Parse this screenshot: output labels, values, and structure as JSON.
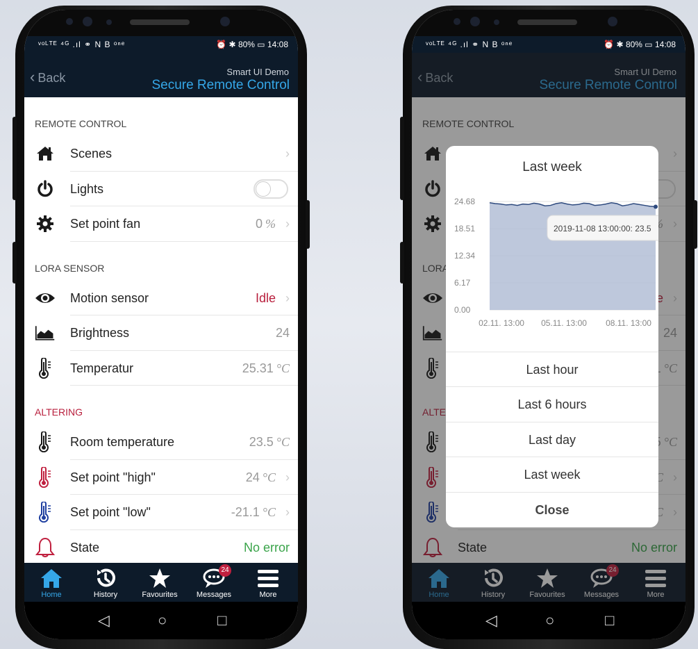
{
  "status": {
    "left_icons": "ᵛᵒᴸᵀᴱ ⁴ᴳ .ıl ⚭ N B ᵒⁿᵉ",
    "right": "⏰ ✱ 80% ▭ 14:08"
  },
  "header": {
    "back_label": "Back",
    "app_subtitle": "Smart UI Demo",
    "app_title": "Secure Remote Control"
  },
  "sections": {
    "remote": "REMOTE CONTROL",
    "lora": "LORA SENSOR",
    "altering": "ALTERING"
  },
  "rows": {
    "scenes": {
      "label": "Scenes"
    },
    "lights": {
      "label": "Lights",
      "on": false
    },
    "fan": {
      "label": "Set point fan",
      "value": "0",
      "unit": "%"
    },
    "motion": {
      "label": "Motion sensor",
      "value": "Idle"
    },
    "brightness": {
      "label": "Brightness",
      "value": "24"
    },
    "temperatur": {
      "label": "Temperatur",
      "value": "25.31",
      "unit": "°C"
    },
    "room": {
      "label": "Room temperature",
      "value": "23.5",
      "unit": "°C"
    },
    "high": {
      "label": "Set point \"high\"",
      "value": "24",
      "unit": "°C"
    },
    "low": {
      "label": "Set point \"low\"",
      "value": "-21.1",
      "unit": "°C"
    },
    "state": {
      "label": "State",
      "value": "No error"
    }
  },
  "tabs": [
    {
      "label": "Home",
      "icon": "home-icon"
    },
    {
      "label": "History",
      "icon": "history-icon"
    },
    {
      "label": "Favourites",
      "icon": "star-icon"
    },
    {
      "label": "Messages",
      "icon": "messages-icon",
      "badge": "24"
    },
    {
      "label": "More",
      "icon": "menu-icon"
    }
  ],
  "sysnav": {
    "back": "◁",
    "home": "○",
    "recent": "□"
  },
  "dialog": {
    "title": "Last week",
    "tooltip": "2019-11-08 13:00:00: 23.5",
    "options": [
      "Last hour",
      "Last 6 hours",
      "Last day",
      "Last week"
    ],
    "close": "Close"
  },
  "colors": {
    "navbar": "#0d1b2a",
    "accent": "#35a7e8",
    "alert_red": "#b81e3c",
    "ok_green": "#3aa44a",
    "chart_fill": "#b7c2d8",
    "chart_line": "#2e4a7e"
  },
  "chart_data": {
    "type": "area",
    "title": "Last week",
    "x_ticks": [
      "02.11. 13:00",
      "05.11. 13:00",
      "08.11. 13:00"
    ],
    "y_ticks": [
      "0.00",
      "6.17",
      "12.34",
      "18.51",
      "24.68"
    ],
    "ylim": [
      0,
      24.68
    ],
    "x": [
      0,
      1,
      2,
      3,
      4,
      5,
      6,
      7,
      8,
      9,
      10,
      11,
      12,
      13,
      14,
      15,
      16,
      17,
      18,
      19,
      20,
      21,
      22,
      23,
      24,
      25,
      26,
      27,
      28,
      29,
      30
    ],
    "values": [
      24.4,
      24.2,
      24.1,
      23.9,
      24.0,
      23.8,
      24.1,
      24.0,
      24.3,
      24.1,
      23.7,
      23.8,
      24.2,
      24.4,
      24.1,
      23.9,
      24.0,
      24.3,
      24.2,
      23.8,
      23.9,
      24.1,
      24.4,
      24.2,
      23.7,
      23.9,
      24.2,
      24.0,
      23.8,
      23.6,
      23.5
    ],
    "grid": true
  }
}
